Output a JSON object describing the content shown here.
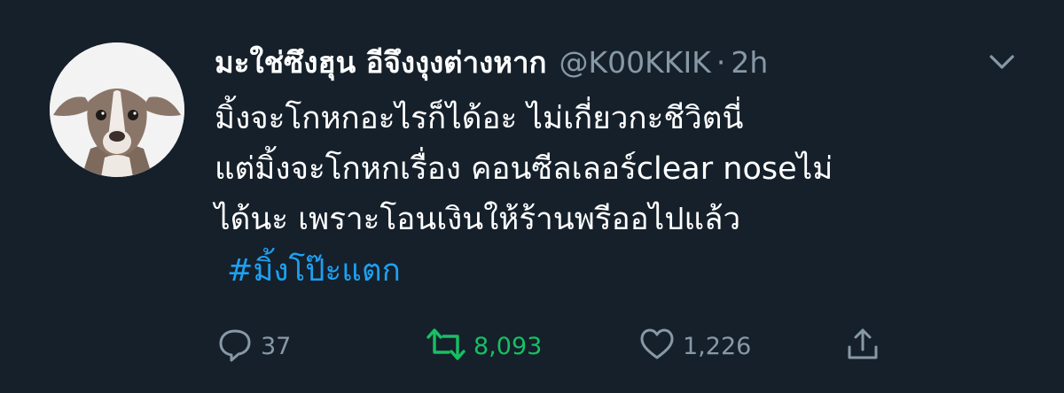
{
  "tweet": {
    "display_name": "มะใช่ซึงฮุน อีจึงงุงต่างหาก",
    "handle": "@K00KKIK",
    "separator": "·",
    "time": "2h",
    "text_lines": [
      "มิ้งจะโกหกอะไรก็ได้อะ ไม่เกี่ยวกะชีวิตนี่",
      "แต่มิ้งจะโกหกเรื่อง คอนซีลเลอร์clear noseไม่",
      "ได้นะ เพราะโอนเงินให้ร้านพรีออไปแล้ว"
    ],
    "hashtag": "#มิ้งโป๊ะแตก"
  },
  "actions": {
    "reply": {
      "icon": "reply-icon",
      "count": "37"
    },
    "retweet": {
      "icon": "retweet-icon",
      "count": "8,093",
      "active_color": "#17bf63"
    },
    "like": {
      "icon": "heart-icon",
      "count": "1,226"
    },
    "share": {
      "icon": "share-icon"
    }
  },
  "colors": {
    "background": "#15202b",
    "secondary_text": "#8899a6",
    "link": "#1da1f2",
    "retweet_active": "#17bf63"
  }
}
